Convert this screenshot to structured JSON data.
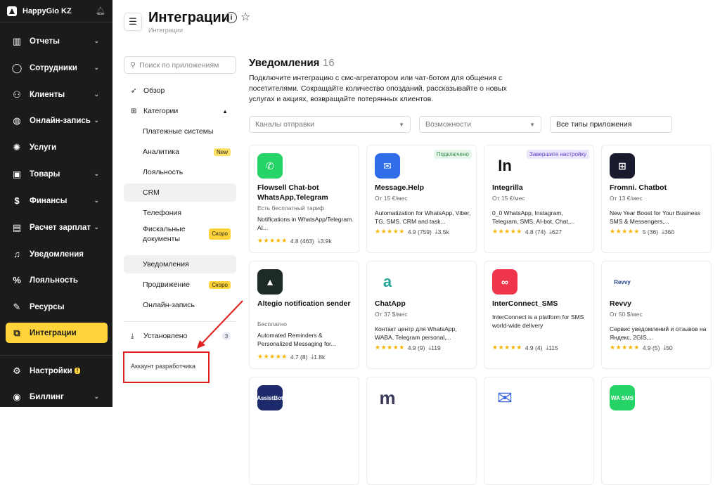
{
  "brand": {
    "name": "HappyGio KZ"
  },
  "sidebar": {
    "items": [
      {
        "label": "Отчеты",
        "icon": "reports-icon",
        "glyph": "▥",
        "chevron": true
      },
      {
        "label": "Сотрудники",
        "icon": "user-icon",
        "glyph": "◯",
        "chevron": true
      },
      {
        "label": "Клиенты",
        "icon": "clients-icon",
        "glyph": "⚇",
        "chevron": true
      },
      {
        "label": "Онлайн-запись",
        "icon": "globe-icon",
        "glyph": "◍",
        "chevron": true
      },
      {
        "label": "Услуги",
        "icon": "services-icon",
        "glyph": "✺",
        "chevron": false
      },
      {
        "label": "Товары",
        "icon": "products-icon",
        "glyph": "▣",
        "chevron": true
      },
      {
        "label": "Финансы",
        "icon": "finance-icon",
        "glyph": "$",
        "chevron": true
      },
      {
        "label": "Расчет зарплат",
        "icon": "payroll-icon",
        "glyph": "▤",
        "chevron": true
      },
      {
        "label": "Уведомления",
        "icon": "bell-icon",
        "glyph": "♫",
        "chevron": false
      },
      {
        "label": "Лояльность",
        "icon": "loyalty-icon",
        "glyph": "%",
        "chevron": false
      },
      {
        "label": "Ресурсы",
        "icon": "resources-icon",
        "glyph": "✎",
        "chevron": false
      },
      {
        "label": "Интеграции",
        "icon": "integrations-icon",
        "glyph": "⧉",
        "chevron": false,
        "active": true
      }
    ],
    "settings": {
      "label": "Настройки",
      "badge": "!"
    },
    "billing": {
      "label": "Биллинг"
    }
  },
  "header": {
    "title": "Интеграции",
    "breadcrumb": "Интеграции"
  },
  "search": {
    "placeholder": "Поиск по приложениям"
  },
  "categories": {
    "overview": "Обзор",
    "categories": "Категории",
    "items": [
      {
        "label": "Платежные системы"
      },
      {
        "label": "Аналитика",
        "tag": "New"
      },
      {
        "label": "Лояльность"
      },
      {
        "label": "CRM",
        "selected": true
      },
      {
        "label": "Телефония"
      },
      {
        "label": "Фискальные документы",
        "tag": "Скоро",
        "soon": true
      },
      {
        "label": "Уведомления",
        "selected": true
      },
      {
        "label": "Продвижение",
        "tag": "Скоро",
        "soon": true
      },
      {
        "label": "Онлайн-запись"
      }
    ],
    "installed": {
      "label": "Установлено",
      "count": "3"
    },
    "developer": "Аккаунт разработчика"
  },
  "section": {
    "title": "Уведомления",
    "count": "16",
    "description": "Подключите интеграцию с смс-агрегатором или чат-ботом для общения с посетителями. Сокращайте количество опозданий, рассказывайте о новых услугах и акциях, возвращайте потерянных клиентов."
  },
  "filters": {
    "channels": "Каналы отправки",
    "features": "Возможности",
    "types": "Все типы приложения"
  },
  "cards": [
    {
      "name": "Flowsell Chat-bot WhatsApp,Telegram",
      "price": "Есть бесплатный тариф",
      "desc": "Notifications in WhatsApp/Telegram. AI...",
      "rating": "4.8 (463)",
      "downloads": "3.9k",
      "logo_color": "#25d366",
      "logo_glyph": "✆",
      "logo_icon": "whatsapp-icon"
    },
    {
      "name": "Message.Help",
      "price": "От 15 €/мес",
      "desc": "Automatization for WhatsApp, Viber, TG, SMS. CRM and task...",
      "rating": "4.9 (759)",
      "downloads": "3.5k",
      "logo_color": "#2f6ee8",
      "logo_glyph": "✉",
      "logo_icon": "message-icon",
      "badge": "Подключено"
    },
    {
      "name": "Integrilla",
      "price": "От 15 €/мес",
      "desc": "0_0 WhatsApp, Instagram, Telegram, SMS, AI-bot, Chat,...",
      "rating": "4.8 (74)",
      "downloads": "627",
      "logo_color": "#ffffff",
      "logo_glyph": "In",
      "logo_icon": "integrilla-icon",
      "badge2": "Завершите настройку"
    },
    {
      "name": "Fromni. Chatbot",
      "price": "От 13 €/мес",
      "desc": "New Year Boost for Your Business SMS & Messengers,...",
      "rating": "5 (36)",
      "downloads": "360",
      "logo_color": "#1a1a2e",
      "logo_glyph": "⊞",
      "logo_icon": "fromni-icon"
    },
    {
      "name": "Altegio notification sender",
      "price": "Бесплатно",
      "desc": "Automated Reminders & Personalized Messaging for...",
      "rating": "4.7 (8)",
      "downloads": "1.8k",
      "logo_color": "#1e2a24",
      "logo_glyph": "▲",
      "logo_icon": "altegio-icon"
    },
    {
      "name": "ChatApp",
      "price": "От 37 $/мес",
      "desc": "Контакт центр для WhatsApp, WABA, Telegram personal,...",
      "rating": "4.9 (9)",
      "downloads": "119",
      "logo_color": "#ffffff",
      "logo_glyph": "a",
      "logo_icon": "chatapp-icon"
    },
    {
      "name": "InterConnect_SMS",
      "price": "",
      "desc": "InterConnect is a platform for SMS world-wide delivery",
      "rating": "4.9 (4)",
      "downloads": "115",
      "logo_color": "#f0364a",
      "logo_glyph": "∞",
      "logo_icon": "interconnect-icon"
    },
    {
      "name": "Revvy",
      "price": "От 50 $/мес",
      "desc": "Сервис уведомлений и отзывов на Яндекс, 2GIS,...",
      "rating": "4.9 (5)",
      "downloads": "50",
      "logo_color": "#ffffff",
      "logo_glyph": "Revvy",
      "logo_icon": "revvy-icon"
    },
    {
      "name": "",
      "logo_color": "#1d2a6b",
      "logo_glyph": "AssistBot",
      "logo_icon": "assistbot-icon"
    },
    {
      "name": "",
      "logo_color": "#ffffff",
      "logo_glyph": "m",
      "logo_icon": "m-icon"
    },
    {
      "name": "",
      "logo_color": "#ffffff",
      "logo_glyph": "✉",
      "logo_icon": "mail-icon"
    },
    {
      "name": "",
      "logo_color": "#25d366",
      "logo_glyph": "WA SMS",
      "logo_icon": "wa-sms-icon"
    }
  ],
  "stars": "★★★★★"
}
